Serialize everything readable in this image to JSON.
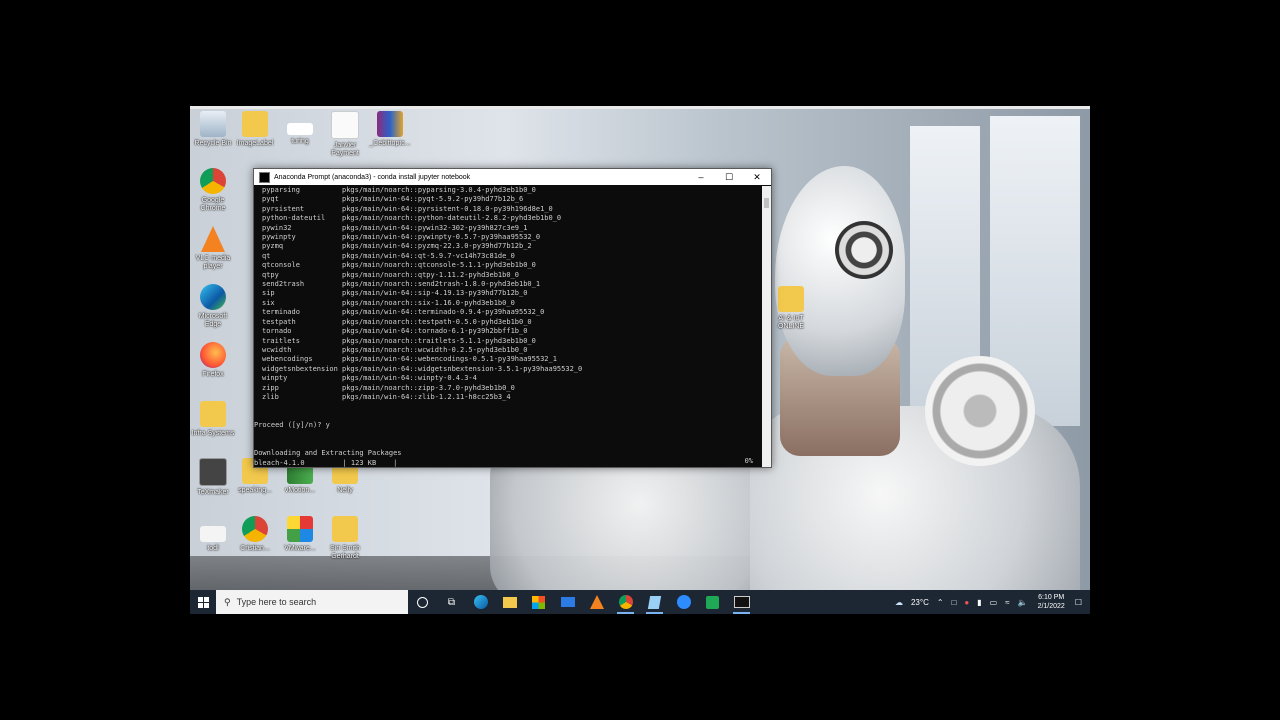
{
  "desktop_icons": [
    {
      "label": "Recycle Bin"
    },
    {
      "label": "ImageLabel"
    },
    {
      "label": "turing"
    },
    {
      "label": "Janvier\nPayment"
    },
    {
      "label": "_Cebittoptc..."
    },
    {
      "label": "Google\nChrome"
    },
    {
      "label": "VLC media\nplayer"
    },
    {
      "label": "Microsoft\nEdge"
    },
    {
      "label": "Firefox"
    },
    {
      "label": "Infra Systems"
    },
    {
      "label": "TeXmaker"
    },
    {
      "label": "speaking..."
    },
    {
      "label": "vMotion..."
    },
    {
      "label": "Nelly"
    },
    {
      "label": "todl"
    },
    {
      "label": "Cristian..."
    },
    {
      "label": "VMware..."
    },
    {
      "label": "Siri Smith\nGerhardt"
    },
    {
      "label": "AI & IoT\nONLINE"
    }
  ],
  "terminal": {
    "title": "Anaconda Prompt (anaconda3) - conda  install jupyter notebook",
    "packages": [
      {
        "name": "pyparsing",
        "spec": "pkgs/main/noarch::pyparsing-3.0.4-pyhd3eb1b0_0"
      },
      {
        "name": "pyqt",
        "spec": "pkgs/main/win-64::pyqt-5.9.2-py39hd77b12b_6"
      },
      {
        "name": "pyrsistent",
        "spec": "pkgs/main/win-64::pyrsistent-0.18.0-py39h196d8e1_0"
      },
      {
        "name": "python-dateutil",
        "spec": "pkgs/main/noarch::python-dateutil-2.8.2-pyhd3eb1b0_0"
      },
      {
        "name": "pywin32",
        "spec": "pkgs/main/win-64::pywin32-302-py39h827c3e9_1"
      },
      {
        "name": "pywinpty",
        "spec": "pkgs/main/win-64::pywinpty-0.5.7-py39haa95532_0"
      },
      {
        "name": "pyzmq",
        "spec": "pkgs/main/win-64::pyzmq-22.3.0-py39hd77b12b_2"
      },
      {
        "name": "qt",
        "spec": "pkgs/main/win-64::qt-5.9.7-vc14h73c81de_0"
      },
      {
        "name": "qtconsole",
        "spec": "pkgs/main/noarch::qtconsole-5.1.1-pyhd3eb1b0_0"
      },
      {
        "name": "qtpy",
        "spec": "pkgs/main/noarch::qtpy-1.11.2-pyhd3eb1b0_0"
      },
      {
        "name": "send2trash",
        "spec": "pkgs/main/noarch::send2trash-1.8.0-pyhd3eb1b0_1"
      },
      {
        "name": "sip",
        "spec": "pkgs/main/win-64::sip-4.19.13-py39hd77b12b_0"
      },
      {
        "name": "six",
        "spec": "pkgs/main/noarch::six-1.16.0-pyhd3eb1b0_0"
      },
      {
        "name": "terminado",
        "spec": "pkgs/main/win-64::terminado-0.9.4-py39haa95532_0"
      },
      {
        "name": "testpath",
        "spec": "pkgs/main/noarch::testpath-0.5.0-pyhd3eb1b0_0"
      },
      {
        "name": "tornado",
        "spec": "pkgs/main/win-64::tornado-6.1-py39h2bbff1b_0"
      },
      {
        "name": "traitlets",
        "spec": "pkgs/main/noarch::traitlets-5.1.1-pyhd3eb1b0_0"
      },
      {
        "name": "wcwidth",
        "spec": "pkgs/main/noarch::wcwidth-0.2.5-pyhd3eb1b0_0"
      },
      {
        "name": "webencodings",
        "spec": "pkgs/main/win-64::webencodings-0.5.1-py39haa95532_1"
      },
      {
        "name": "widgetsnbextension",
        "spec": "pkgs/main/win-64::widgetsnbextension-3.5.1-py39haa95532_0"
      },
      {
        "name": "winpty",
        "spec": "pkgs/main/win-64::winpty-0.4.3-4"
      },
      {
        "name": "zipp",
        "spec": "pkgs/main/noarch::zipp-3.7.0-pyhd3eb1b0_0"
      },
      {
        "name": "zlib",
        "spec": "pkgs/main/win-64::zlib-1.2.11-h8cc25b3_4"
      }
    ],
    "prompt": "Proceed ([y]/n)? y",
    "downloading": "Downloading and Extracting Packages",
    "progress_line": "bleach-4.1.0         | 123 KB    |",
    "progress_pct": "0%"
  },
  "taskbar": {
    "search_placeholder": "Type here to search",
    "weather": "23°C",
    "time": "6:10 PM",
    "date": "2/1/2022"
  },
  "colors": {
    "taskbar_bg": "#1c2733",
    "terminal_bg": "#0c0c0c",
    "terminal_text": "#cfcfcf"
  }
}
